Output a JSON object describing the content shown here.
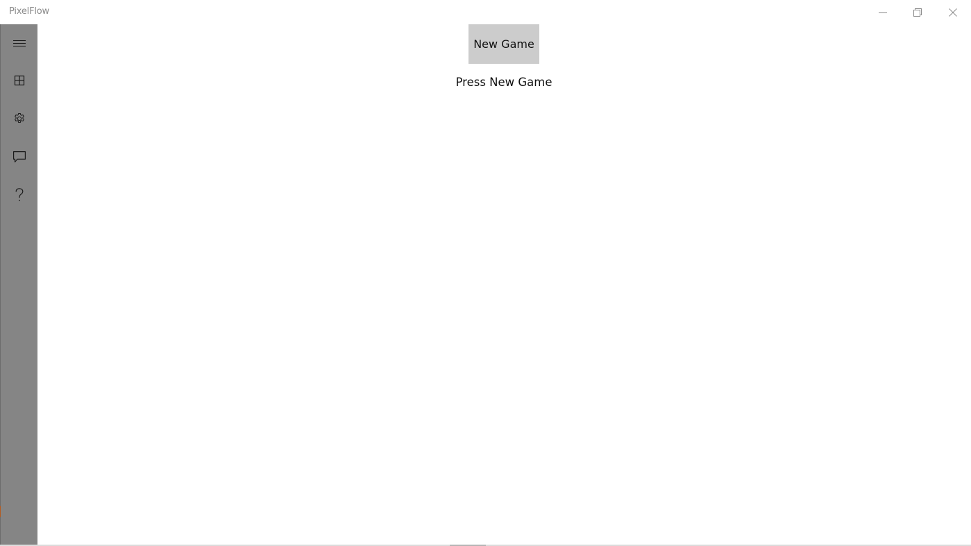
{
  "window": {
    "title": "PixelFlow"
  },
  "caption_buttons": {
    "minimize": "minimize-icon",
    "maximize": "restore-icon",
    "close": "close-icon"
  },
  "sidebar": {
    "background": "#858585",
    "items": [
      {
        "name": "menu",
        "icon": "hamburger-icon"
      },
      {
        "name": "levels",
        "icon": "grid-icon"
      },
      {
        "name": "settings",
        "icon": "gear-icon"
      },
      {
        "name": "feedback",
        "icon": "chat-icon"
      },
      {
        "name": "help",
        "icon": "question-icon"
      }
    ]
  },
  "main": {
    "new_game_label": "New Game",
    "status_text": "Press New Game"
  },
  "colors": {
    "button_bg": "#cccccc",
    "text": "#111111"
  }
}
